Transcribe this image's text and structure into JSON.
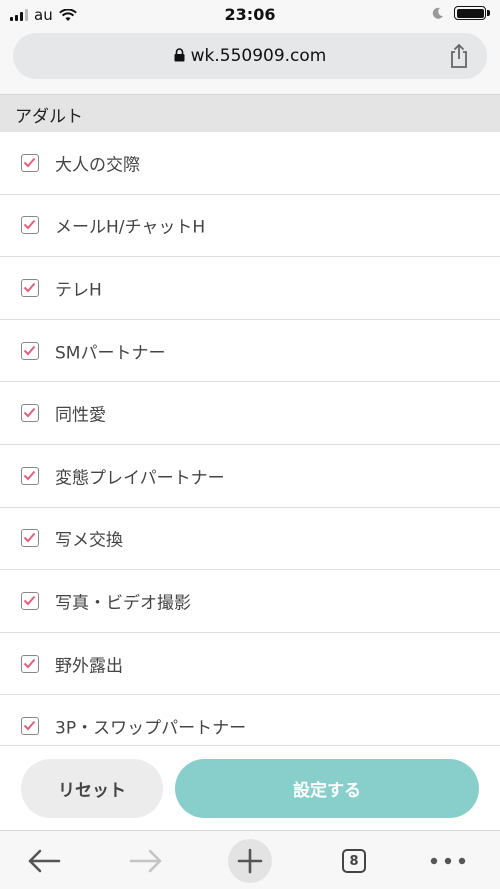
{
  "status_bar": {
    "carrier": "au",
    "time": "23:06",
    "icons": [
      "signal-icon",
      "wifi-icon",
      "moon-icon",
      "battery-icon"
    ]
  },
  "address_bar": {
    "url": "wk.550909.com",
    "icons": [
      "lock-icon",
      "share-icon"
    ]
  },
  "section": {
    "title": "アダルト"
  },
  "options": [
    {
      "label": "大人の交際",
      "checked": true
    },
    {
      "label": "メールH/チャットH",
      "checked": true
    },
    {
      "label": "テレH",
      "checked": true
    },
    {
      "label": "SMパートナー",
      "checked": true
    },
    {
      "label": "同性愛",
      "checked": true
    },
    {
      "label": "変態プレイパートナー",
      "checked": true
    },
    {
      "label": "写メ交換",
      "checked": true
    },
    {
      "label": "写真・ビデオ撮影",
      "checked": true
    },
    {
      "label": "野外露出",
      "checked": true
    },
    {
      "label": "3P・スワップパートナー",
      "checked": true
    }
  ],
  "actions": {
    "reset_label": "リセット",
    "apply_label": "設定する"
  },
  "toolbar": {
    "tab_count": "8",
    "icons": [
      "back-arrow-icon",
      "forward-arrow-icon",
      "new-tab-plus-icon",
      "tabs-icon",
      "more-icon"
    ]
  },
  "colors": {
    "accent": "#88cfcb",
    "check": "#e0607e",
    "header_bg": "#e4e4e4"
  }
}
